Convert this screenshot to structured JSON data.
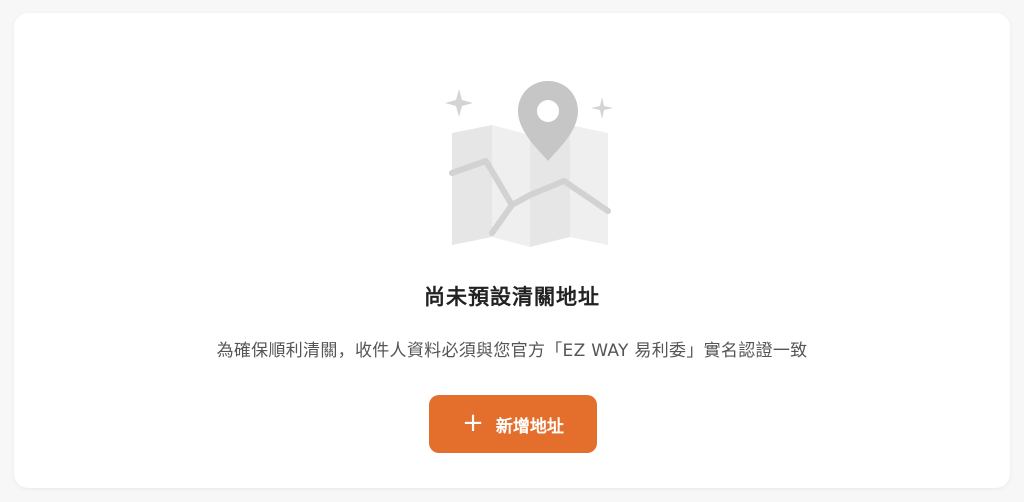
{
  "empty_state": {
    "icon": "map-pin-icon",
    "title": "尚未預設清關地址",
    "description": "為確保順利清關，收件人資料必須與您官方「EZ WAY 易利委」實名認證一致",
    "add_button": {
      "icon": "plus-icon",
      "label": "新增地址"
    }
  },
  "colors": {
    "accent": "#e46e2c",
    "illustration": "#c8c8c8"
  }
}
